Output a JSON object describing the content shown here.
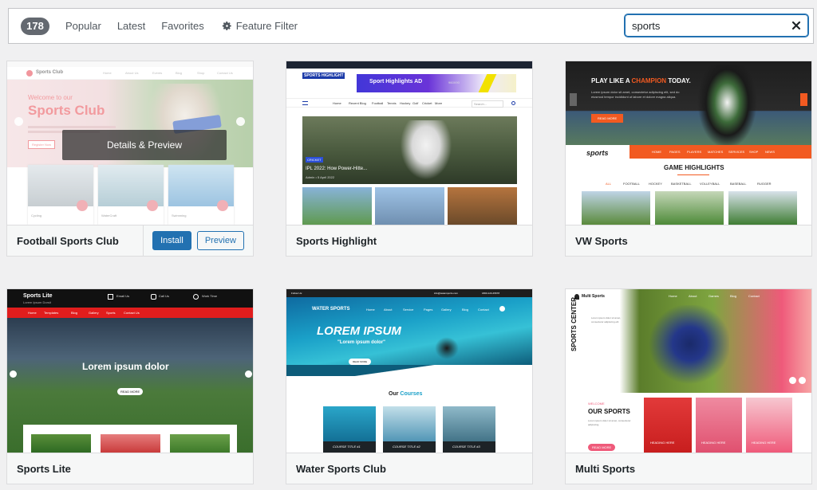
{
  "filter_bar": {
    "count": "178",
    "links": [
      "Popular",
      "Latest",
      "Favorites"
    ],
    "feature_filter_label": "Feature Filter",
    "search_value": "sports"
  },
  "themes": [
    {
      "name": "Football Sports Club",
      "overlay_label": "Details & Preview",
      "install_label": "Install",
      "preview_label": "Preview",
      "screenshot": {
        "brand": "Sports Club",
        "nav": [
          "Home",
          "About Us",
          "Events",
          "Blog",
          "Shop",
          "Contact Us"
        ],
        "hero_line1": "Welcome to our",
        "hero_line2": "Sports Club",
        "hero_button": "Register Now",
        "tiles": [
          "Cycling",
          "WaterCraft",
          "Swimming"
        ]
      }
    },
    {
      "name": "Sports Highlight",
      "screenshot": {
        "logo": "SPORTS HIGHLIGHT",
        "ad": "Sport Highlights AD",
        "ad_sub": "960X90",
        "nav": [
          "Home",
          "Recent Blog",
          "Football",
          "Tennis",
          "Hockey",
          "Golf",
          "Cricket",
          "More",
          "Cricket"
        ],
        "search_placeholder": "Search...",
        "badge": "CRICKET",
        "headline": "IPL 2022: How Power-Hitte...",
        "meta": "Admin • 5 April 2022"
      }
    },
    {
      "name": "VW Sports",
      "screenshot": {
        "headline_a": "PLAY LIKE A ",
        "headline_b": "CHAMPION",
        "headline_c": " TODAY.",
        "body": "Lorem ipsum dolor sit amet, consectetur adipiscing elit, sed do eiusmod tempor incididunt ut labore et dolore magna aliqua.",
        "button": "READ MORE",
        "logo": "sports",
        "nav": [
          "HOME",
          "PAGES",
          "PLAYERS",
          "MATCHES",
          "SERVICES",
          "SHOP",
          "NEWS"
        ],
        "section_title": "GAME HIGHLIGHTS",
        "categories": [
          "ALL",
          "FOOTBALL",
          "HOCKEY",
          "BASKETBALL",
          "VOLLEYBALL",
          "BASEBALL",
          "RUGGER"
        ]
      }
    },
    {
      "name": "Sports Lite",
      "screenshot": {
        "brand": "Sports Lite",
        "tagline": "Lorem Ipsum Dorsit",
        "contact_email_label": "Email Us",
        "contact_phone_label": "Call Us",
        "contact_time_label": "Work Time",
        "nav": [
          "Home",
          "Templates",
          "Blog",
          "Gallery",
          "Sports",
          "Contact Us"
        ],
        "hero": "Lorem ipsum dolor",
        "hero_button": "READ MORE"
      }
    },
    {
      "name": "Water Sports Club",
      "screenshot": {
        "follow_label": "Follow Us:",
        "email": "info@watersports.com",
        "phone": "1800-123-45678",
        "brand": "WATER SPORTS",
        "nav": [
          "Home",
          "About",
          "Service",
          "Pages",
          "Gallery",
          "Blog",
          "Contact"
        ],
        "hero": "LOREM IPSUM",
        "hero_sub": "\"Lorem ipsum dolor\"",
        "hero_button": "READ MORE",
        "section_a": "Our ",
        "section_b": "Courses",
        "courses": [
          "COURSE TITLE #1",
          "COURSE TITLE #2",
          "COURSE TITLE #3"
        ]
      }
    },
    {
      "name": "Multi Sports",
      "screenshot": {
        "brand": "Multi Sports",
        "nav": [
          "Home",
          "About",
          "Games",
          "Blog",
          "Contact"
        ],
        "vertical_title": "SPORTS CENTER",
        "vertical_body": "Lorem ipsum dolor sit amet, consectetur adipiscing elit",
        "kicker": "WELCOME",
        "section_title": "OUR SPORTS",
        "body": "Lorem ipsum dolor sit amet, consectetur adipiscing.",
        "button": "READ MORE",
        "cards": [
          "HEADING HERE",
          "HEADING HERE",
          "HEADING HERE"
        ]
      }
    }
  ],
  "colors": {
    "accent": "#2271b1",
    "badge": "#646970",
    "vw_orange": "#f25a21",
    "sports_lite_red": "#e11d1d",
    "multi_pink": "#ef5a7a"
  }
}
